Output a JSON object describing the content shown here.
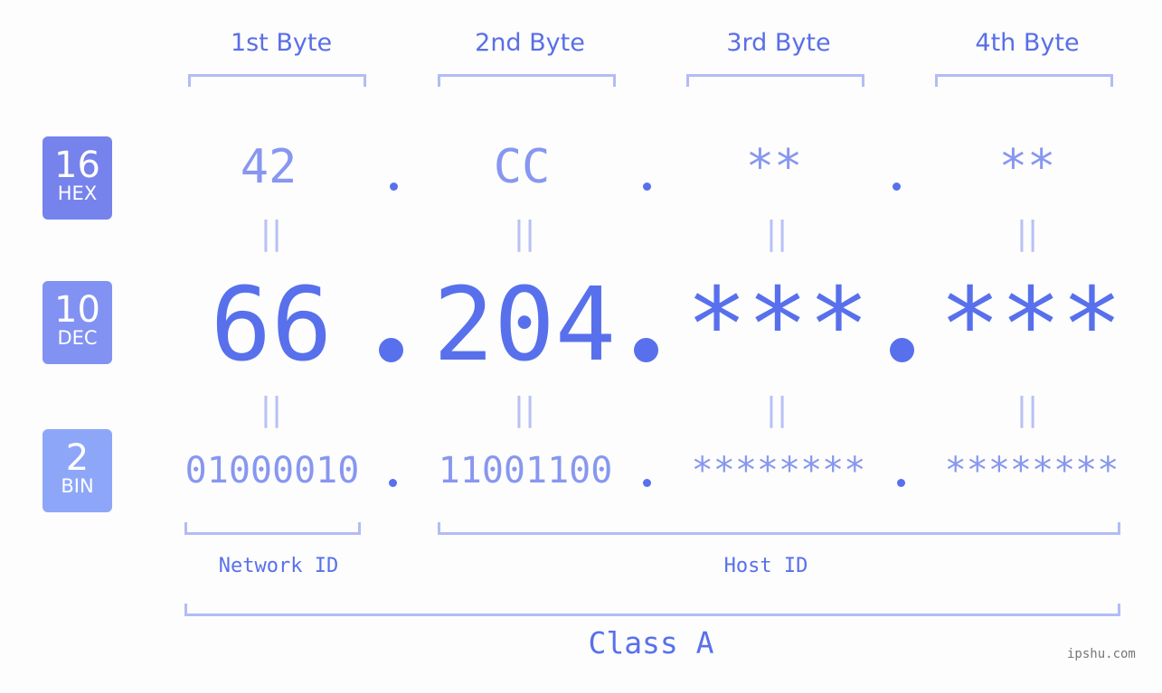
{
  "headers": [
    "1st Byte",
    "2nd Byte",
    "3rd Byte",
    "4th Byte"
  ],
  "badges": {
    "hex": {
      "num": "16",
      "label": "HEX",
      "color": "#7683ec"
    },
    "dec": {
      "num": "10",
      "label": "DEC",
      "color": "#8292f2"
    },
    "bin": {
      "num": "2",
      "label": "BIN",
      "color": "#8ea6f8"
    }
  },
  "hex_values": [
    "42",
    "CC",
    "**",
    "**"
  ],
  "dec_values": [
    "66",
    "204",
    "***",
    "***"
  ],
  "bin_values": [
    "01000010",
    "11001100",
    "********",
    "********"
  ],
  "equals_symbol": "||",
  "network_id_label": "Network ID",
  "host_id_label": "Host ID",
  "class_label": "Class A",
  "watermark": "ipshu.com",
  "colors": {
    "primary": "#5870ec",
    "secondary": "#8797f0",
    "bracket": "#b3bcf6",
    "background": "#fcfdfc"
  }
}
